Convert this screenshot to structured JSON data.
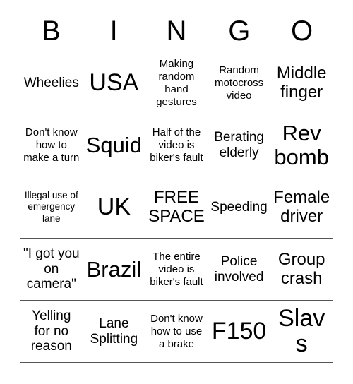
{
  "card": {
    "header_letters": [
      "B",
      "I",
      "N",
      "G",
      "O"
    ],
    "free_space_label": "FREE SPACE",
    "rows": [
      [
        {
          "text": "Wheelies",
          "size": "sm"
        },
        {
          "text": "USA",
          "size": "xl"
        },
        {
          "text": "Making random hand gestures",
          "size": "xs"
        },
        {
          "text": "Random motocross video",
          "size": "xs"
        },
        {
          "text": "Middle finger",
          "size": "md"
        }
      ],
      [
        {
          "text": "Don't know how to make a turn",
          "size": "xs"
        },
        {
          "text": "Squid",
          "size": "lg"
        },
        {
          "text": "Half of the video is biker's fault",
          "size": "xs"
        },
        {
          "text": "Berating elderly",
          "size": "sm"
        },
        {
          "text": "Rev bomb",
          "size": "lg"
        }
      ],
      [
        {
          "text": "Illegal use of emergency lane",
          "size": "xxs"
        },
        {
          "text": "UK",
          "size": "xl"
        },
        {
          "text": "FREE SPACE",
          "size": "md"
        },
        {
          "text": "Speeding",
          "size": "sm"
        },
        {
          "text": "Female driver",
          "size": "md"
        }
      ],
      [
        {
          "text": "\"I got you on camera\"",
          "size": "sm"
        },
        {
          "text": "Brazil",
          "size": "lg"
        },
        {
          "text": "The entire video is biker's fault",
          "size": "xs"
        },
        {
          "text": "Police involved",
          "size": "sm"
        },
        {
          "text": "Group crash",
          "size": "md"
        }
      ],
      [
        {
          "text": "Yelling for no reason",
          "size": "sm"
        },
        {
          "text": "Lane Splitting",
          "size": "sm"
        },
        {
          "text": "Don't know how to use a brake",
          "size": "xs"
        },
        {
          "text": "F150",
          "size": "xl"
        },
        {
          "text": "Slavs",
          "size": "xl"
        }
      ]
    ]
  }
}
